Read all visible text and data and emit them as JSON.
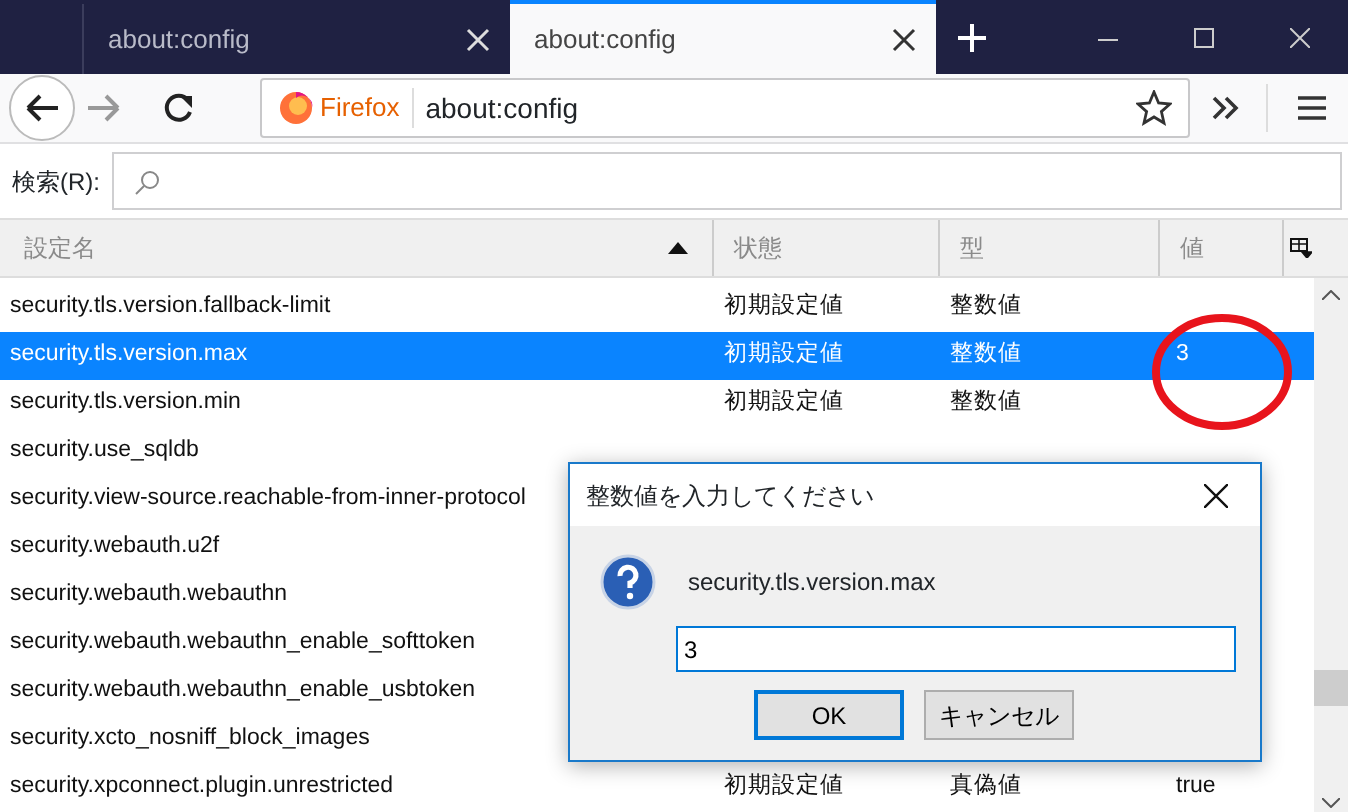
{
  "tabs": [
    {
      "label": "about:config",
      "selected": false
    },
    {
      "label": "about:config",
      "selected": true
    }
  ],
  "toolbar": {
    "identity": "Firefox",
    "url": "about:config"
  },
  "search": {
    "label": "検索(R):"
  },
  "table": {
    "columns": [
      "設定名",
      "状態",
      "型",
      "値"
    ],
    "rows": [
      {
        "name": "security.tls.version.fallback-limit",
        "status": "初期設定値",
        "type": "整数値",
        "selected": false,
        "circled": false
      },
      {
        "name": "security.tls.version.max",
        "status": "初期設定値",
        "type": "整数値",
        "value": "3",
        "selected": true,
        "circled": true
      },
      {
        "name": "security.tls.version.min",
        "status": "初期設定値",
        "type": "整数値",
        "selected": false,
        "circled": false
      },
      {
        "name": "security.use_sqldb",
        "selected": false,
        "circled": false
      },
      {
        "name": "security.view-source.reachable-from-inner-protocol",
        "selected": false,
        "circled": false
      },
      {
        "name": "security.webauth.u2f",
        "selected": false,
        "circled": false
      },
      {
        "name": "security.webauth.webauthn",
        "selected": false,
        "circled": false
      },
      {
        "name": "security.webauth.webauthn_enable_softtoken",
        "selected": false,
        "circled": false
      },
      {
        "name": "security.webauth.webauthn_enable_usbtoken",
        "selected": false,
        "circled": false
      },
      {
        "name": "security.xcto_nosniff_block_images",
        "selected": false,
        "circled": false
      },
      {
        "name": "security.xpconnect.plugin.unrestricted",
        "status": "初期設定値",
        "type": "真偽値",
        "value": "true",
        "selected": false,
        "circled": false
      }
    ]
  },
  "dialog": {
    "title": "整数値を入力してください",
    "message": "security.tls.version.max",
    "value": "3",
    "buttons": [
      "OK",
      "キャンセル"
    ]
  }
}
